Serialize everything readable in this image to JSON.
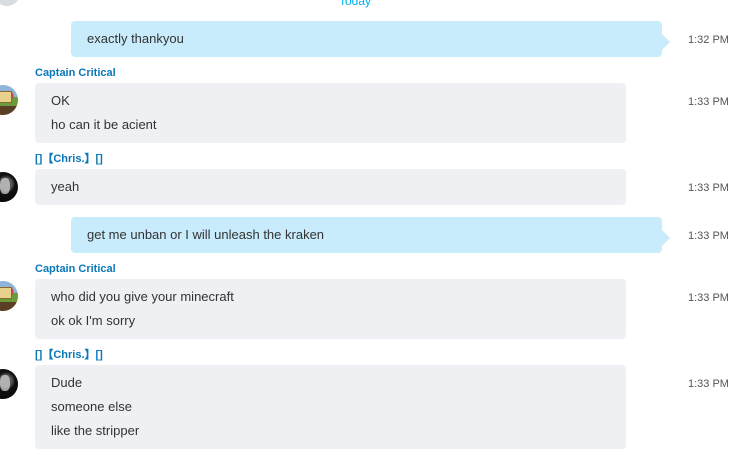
{
  "date_separator": "Today",
  "messages": [
    {
      "side": "out",
      "lines": [
        "exactly thankyou"
      ],
      "time": "1:32 PM"
    },
    {
      "side": "in",
      "sender": "Captain Critical",
      "lines": [
        "OK",
        "ho can it be acient"
      ],
      "time": "1:33 PM"
    },
    {
      "side": "in",
      "sender": "[]【Chris.】[]",
      "lines": [
        "yeah"
      ],
      "time": "1:33 PM"
    },
    {
      "side": "out",
      "lines": [
        "get me unban or I will unleash the kraken"
      ],
      "time": "1:33 PM"
    },
    {
      "side": "in",
      "sender": "Captain Critical",
      "lines": [
        "who did you give your minecraft",
        "ok ok I'm sorry"
      ],
      "time": "1:33 PM"
    },
    {
      "side": "in",
      "sender": "[]【Chris.】[]",
      "lines": [
        "Dude",
        "someone else",
        "like the stripper"
      ],
      "time": "1:33 PM"
    }
  ]
}
